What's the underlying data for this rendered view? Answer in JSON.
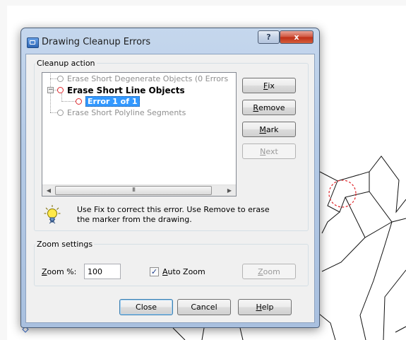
{
  "window": {
    "title": "Drawing Cleanup Errors",
    "help_caption": "?",
    "close_caption": "x"
  },
  "cleanup_action": {
    "legend": "Cleanup action",
    "tree": [
      {
        "label": "Erase Short Degenerate Objects (0 Errors",
        "state": "inactive"
      },
      {
        "label": "Erase Short Line Objects",
        "state": "active"
      },
      {
        "label": "Error 1 of 1",
        "state": "selected"
      },
      {
        "label": "Erase Short Polyline Segments",
        "state": "inactive"
      }
    ],
    "expander_symbol": "−",
    "scrollbar": {
      "left": "◀",
      "right": "▶",
      "thumb": "III"
    },
    "buttons": {
      "fix": {
        "key": "F",
        "rest": "ix"
      },
      "remove": {
        "key": "R",
        "rest": "emove"
      },
      "mark": {
        "key": "M",
        "rest": "ark"
      },
      "next": {
        "key": "N",
        "rest": "ext"
      }
    },
    "info_line1": "Use Fix to correct this error. Use Remove to erase",
    "info_line2": "the  marker from the drawing."
  },
  "zoom_settings": {
    "legend": "Zoom settings",
    "zoom_label_a": "Z",
    "zoom_label_b": "oom %:",
    "zoom_value": "100",
    "auto_zoom_checked": true,
    "check_mark": "✓",
    "auto_zoom_key": "A",
    "auto_zoom_rest": "uto Zoom",
    "zoom_button": {
      "key": "Z",
      "rest": "oom"
    }
  },
  "footer": {
    "close": "Close",
    "cancel": "Cancel",
    "help": {
      "key": "H",
      "rest": "elp"
    }
  },
  "colors": {
    "error_marker": "#e0262b",
    "selection": "#3399ff",
    "drawing_lines": "#000000"
  }
}
